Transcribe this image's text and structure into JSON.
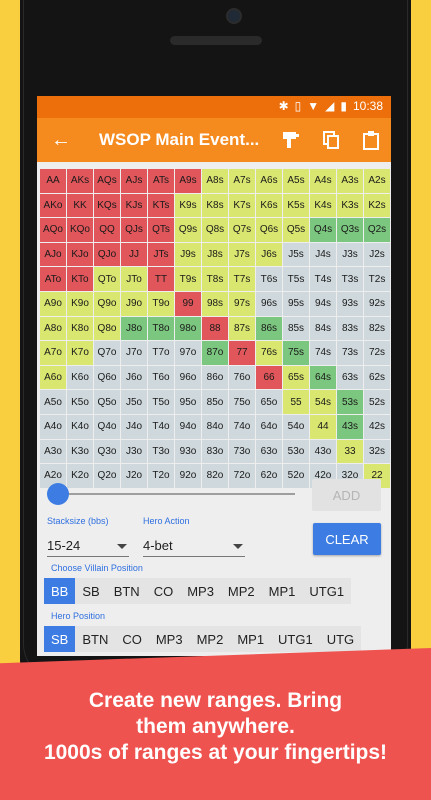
{
  "colors": {
    "accent": "#f58a1f",
    "status_bar": "#ec6f0c",
    "primary_button": "#3d7de3",
    "banner": "#ef5350",
    "background": "#f9cf3f"
  },
  "status": {
    "time": "10:38"
  },
  "appbar": {
    "back_icon": "arrow-back-icon",
    "title": "WSOP Main Event...",
    "icons": [
      "brush-icon",
      "copy-icon",
      "clipboard-icon"
    ]
  },
  "grid": {
    "cells": [
      [
        "AA",
        "AKs",
        "AQs",
        "AJs",
        "ATs",
        "A9s",
        "A8s",
        "A7s",
        "A6s",
        "A5s",
        "A4s",
        "A3s",
        "A2s"
      ],
      [
        "AKo",
        "KK",
        "KQs",
        "KJs",
        "KTs",
        "K9s",
        "K8s",
        "K7s",
        "K6s",
        "K5s",
        "K4s",
        "K3s",
        "K2s"
      ],
      [
        "AQo",
        "KQo",
        "QQ",
        "QJs",
        "QTs",
        "Q9s",
        "Q8s",
        "Q7s",
        "Q6s",
        "Q5s",
        "Q4s",
        "Q3s",
        "Q2s"
      ],
      [
        "AJo",
        "KJo",
        "QJo",
        "JJ",
        "JTs",
        "J9s",
        "J8s",
        "J7s",
        "J6s",
        "J5s",
        "J4s",
        "J3s",
        "J2s"
      ],
      [
        "ATo",
        "KTo",
        "QTo",
        "JTo",
        "TT",
        "T9s",
        "T8s",
        "T7s",
        "T6s",
        "T5s",
        "T4s",
        "T3s",
        "T2s"
      ],
      [
        "A9o",
        "K9o",
        "Q9o",
        "J9o",
        "T9o",
        "99",
        "98s",
        "97s",
        "96s",
        "95s",
        "94s",
        "93s",
        "92s"
      ],
      [
        "A8o",
        "K8o",
        "Q8o",
        "J8o",
        "T8o",
        "98o",
        "88",
        "87s",
        "86s",
        "85s",
        "84s",
        "83s",
        "82s"
      ],
      [
        "A7o",
        "K7o",
        "Q7o",
        "J7o",
        "T7o",
        "97o",
        "87o",
        "77",
        "76s",
        "75s",
        "74s",
        "73s",
        "72s"
      ],
      [
        "A6o",
        "K6o",
        "Q6o",
        "J6o",
        "T6o",
        "96o",
        "86o",
        "76o",
        "66",
        "65s",
        "64s",
        "63s",
        "62s"
      ],
      [
        "A5o",
        "K5o",
        "Q5o",
        "J5o",
        "T5o",
        "95o",
        "85o",
        "75o",
        "65o",
        "55",
        "54s",
        "53s",
        "52s"
      ],
      [
        "A4o",
        "K4o",
        "Q4o",
        "J4o",
        "T4o",
        "94o",
        "84o",
        "74o",
        "64o",
        "54o",
        "44",
        "43s",
        "42s"
      ],
      [
        "A3o",
        "K3o",
        "Q3o",
        "J3o",
        "T3o",
        "93o",
        "83o",
        "73o",
        "63o",
        "53o",
        "43o",
        "33",
        "32s"
      ],
      [
        "A2o",
        "K2o",
        "Q2o",
        "J2o",
        "T2o",
        "92o",
        "82o",
        "72o",
        "62o",
        "52o",
        "42o",
        "32o",
        "22"
      ]
    ],
    "states": [
      "RRRRRRYYYYYYY",
      "RRRRRYYYYYYYY",
      "RRRRRYYYYYGGG",
      "RRRRRYYYYSSSS",
      "RRYYRYYYSSSSS",
      "YYYYYRYYSSSSS",
      "YYYGGGRYGSSSS",
      "YYSSSSGRYGSSS",
      "YSSSSSSSRYGSS",
      "SSSSSSSSSYYGS",
      "SSSSSSSSSSYGS",
      "SSSSSSSSSSSYS",
      "SSSSSSSSSSSSY"
    ],
    "state_colors": {
      "R": "#e0565b",
      "Y": "#d9e66f",
      "G": "#7cc77f",
      "S": "#cfd8dc"
    }
  },
  "controls": {
    "add_label": "ADD",
    "clear_label": "CLEAR",
    "stacksize_label": "Stacksize (bbs)",
    "stacksize_value": "15-24",
    "hero_action_label": "Hero Action",
    "hero_action_value": "4-bet",
    "villain_label": "Choose Villain Position",
    "villain_positions": [
      "BB",
      "SB",
      "BTN",
      "CO",
      "MP3",
      "MP2",
      "MP1",
      "UTG1"
    ],
    "villain_selected": 0,
    "hero_label": "Hero Position",
    "hero_positions": [
      "SB",
      "BTN",
      "CO",
      "MP3",
      "MP2",
      "MP1",
      "UTG1",
      "UTG"
    ],
    "hero_selected": 0
  },
  "banner": {
    "line1": "Create new ranges. Bring",
    "line2": "them anywhere.",
    "line3": "1000s of ranges at your fingertips!"
  }
}
